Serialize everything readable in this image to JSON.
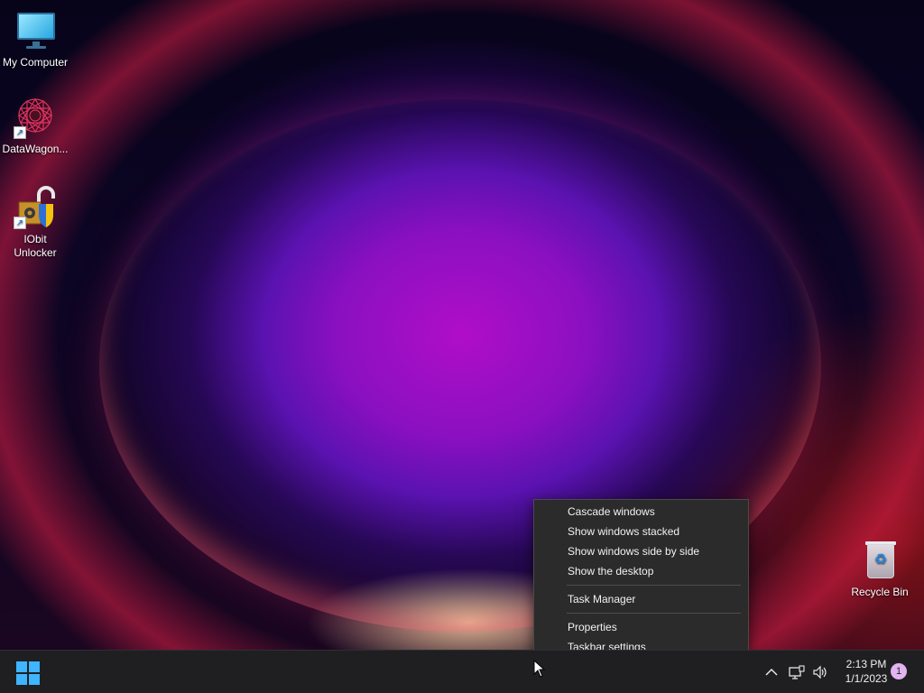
{
  "desktop": {
    "icons": [
      {
        "label": "My Computer",
        "icon": "computer-icon"
      },
      {
        "label": "DataWagon...",
        "icon": "datawagon-icon"
      },
      {
        "label": "IObit Unlocker",
        "icon": "iobit-unlocker-icon"
      },
      {
        "label": "Recycle Bin",
        "icon": "recycle-bin-icon"
      }
    ]
  },
  "context_menu": {
    "items": [
      {
        "label": "Cascade windows"
      },
      {
        "label": "Show windows stacked"
      },
      {
        "label": "Show windows side by side"
      },
      {
        "label": "Show the desktop"
      },
      {
        "label": "Task Manager"
      },
      {
        "label": "Properties"
      },
      {
        "label": "Taskbar settings"
      }
    ]
  },
  "taskbar": {
    "start_icon": "windows-logo-icon",
    "tray_icons": [
      "chevron-up-icon",
      "network-icon",
      "volume-icon"
    ],
    "time": "2:13 PM",
    "date": "1/1/2023",
    "notification_count": "1"
  },
  "colors": {
    "accent": "#3fb4ff",
    "menu_bg": "#2b2b2b",
    "taskbar_bg": "#1f1f22"
  }
}
